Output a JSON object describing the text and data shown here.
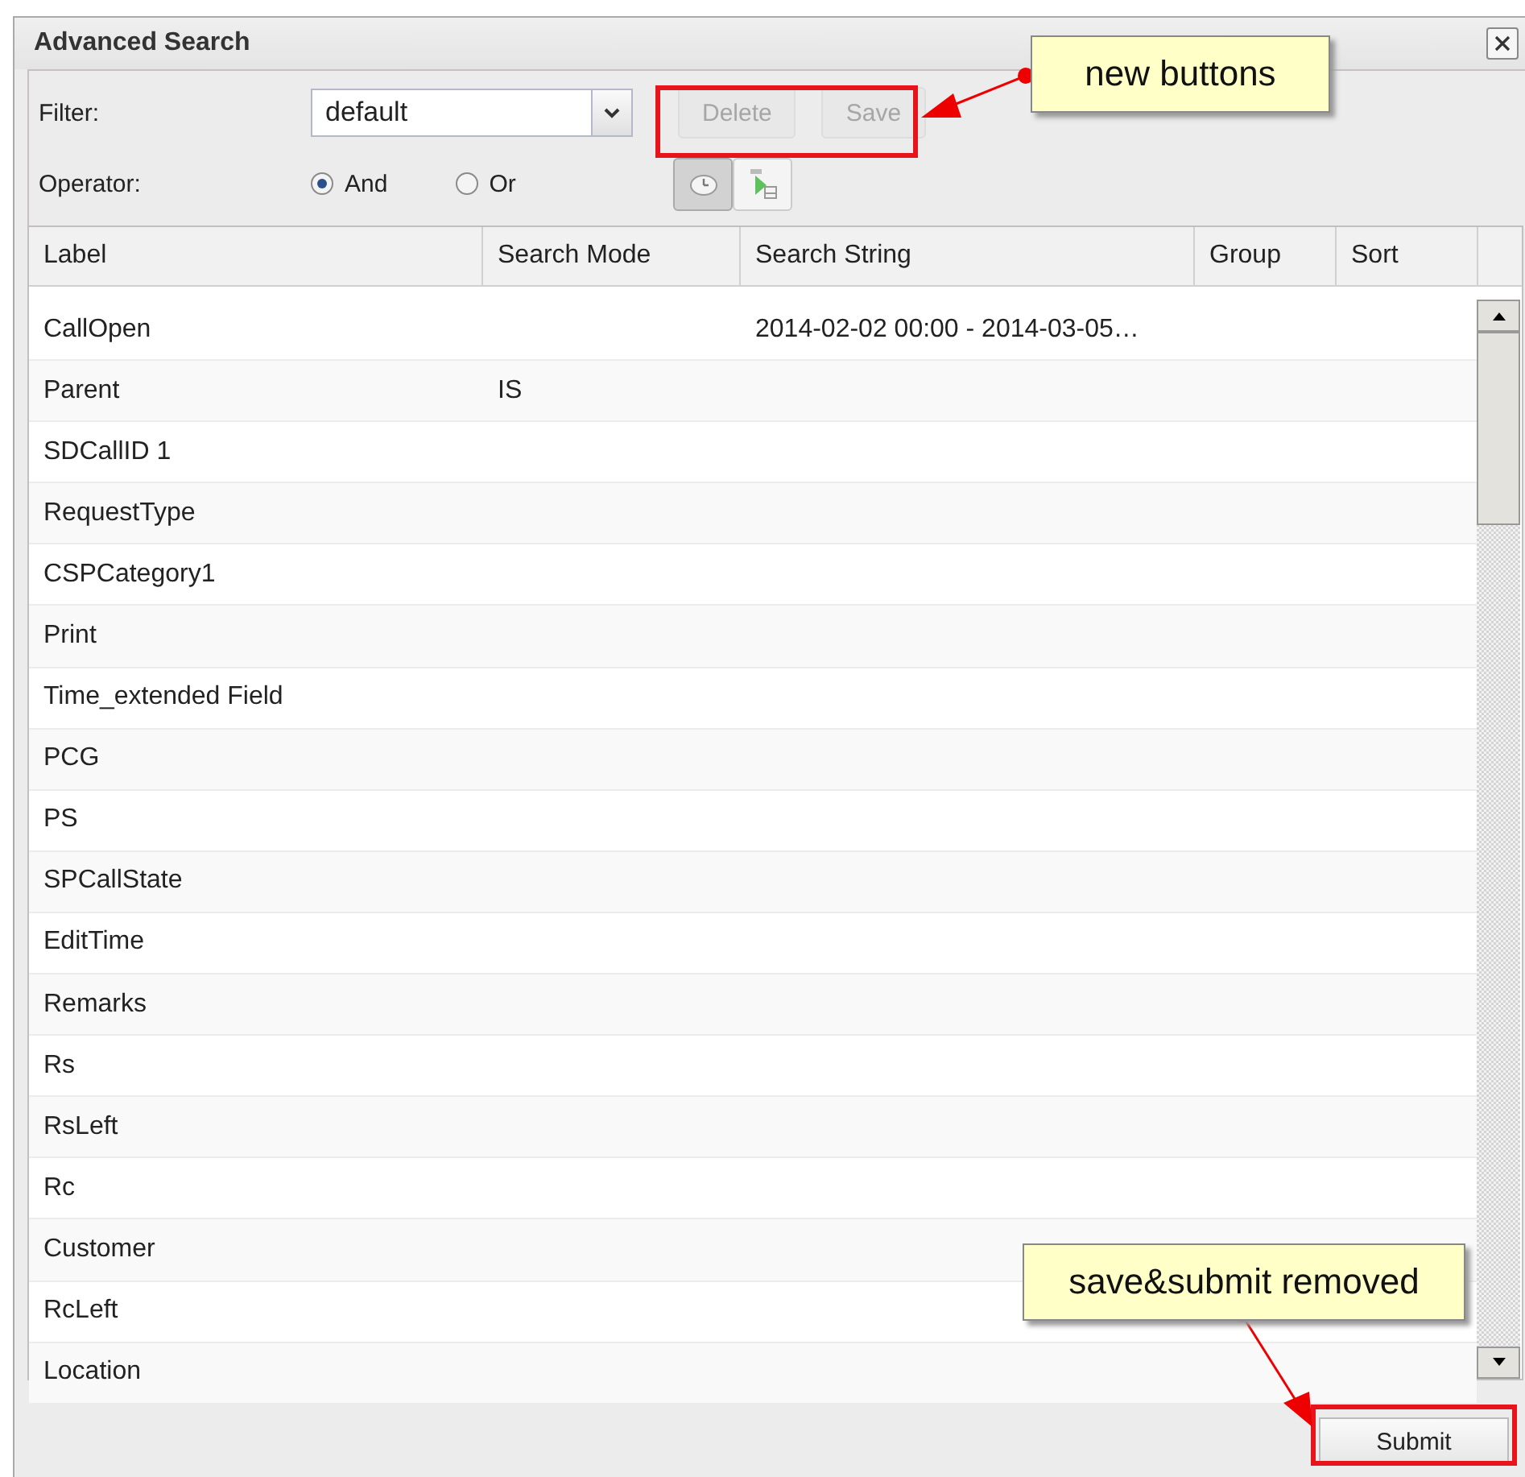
{
  "window": {
    "title": "Advanced Search"
  },
  "filter": {
    "label": "Filter:",
    "value": "default"
  },
  "operator": {
    "label": "Operator:",
    "options": [
      {
        "label": "And",
        "selected": true
      },
      {
        "label": "Or",
        "selected": false
      }
    ]
  },
  "filter_buttons": [
    {
      "label": "Delete",
      "disabled": true
    },
    {
      "label": "Save",
      "disabled": true
    }
  ],
  "tool_buttons": [
    {
      "kind": "clock",
      "pressed": true
    },
    {
      "kind": "flow",
      "pressed": false
    }
  ],
  "table": {
    "columns": [
      "Label",
      "Search Mode",
      "Search String",
      "Group",
      "Sort"
    ],
    "rows": [
      {
        "label": "CallOpen",
        "search_string": "2014-02-02 00:00 - 2014-03-05…"
      },
      {
        "label": "Parent",
        "search_mode": "IS"
      },
      {
        "label": "SDCallID 1"
      },
      {
        "label": "RequestType"
      },
      {
        "label": "CSPCategory1"
      },
      {
        "label": "Print"
      },
      {
        "label": "Time_extended Field"
      },
      {
        "label": "PCG"
      },
      {
        "label": "PS"
      },
      {
        "label": "SPCallState"
      },
      {
        "label": "EditTime"
      },
      {
        "label": "Remarks"
      },
      {
        "label": "Rs"
      },
      {
        "label": "RsLeft"
      },
      {
        "label": "Rc"
      },
      {
        "label": "Customer"
      },
      {
        "label": "RcLeft"
      },
      {
        "label": "Location"
      }
    ]
  },
  "submit": {
    "label": "Submit"
  },
  "annotations": [
    {
      "text": "new buttons"
    },
    {
      "text": "save&submit removed"
    }
  ]
}
